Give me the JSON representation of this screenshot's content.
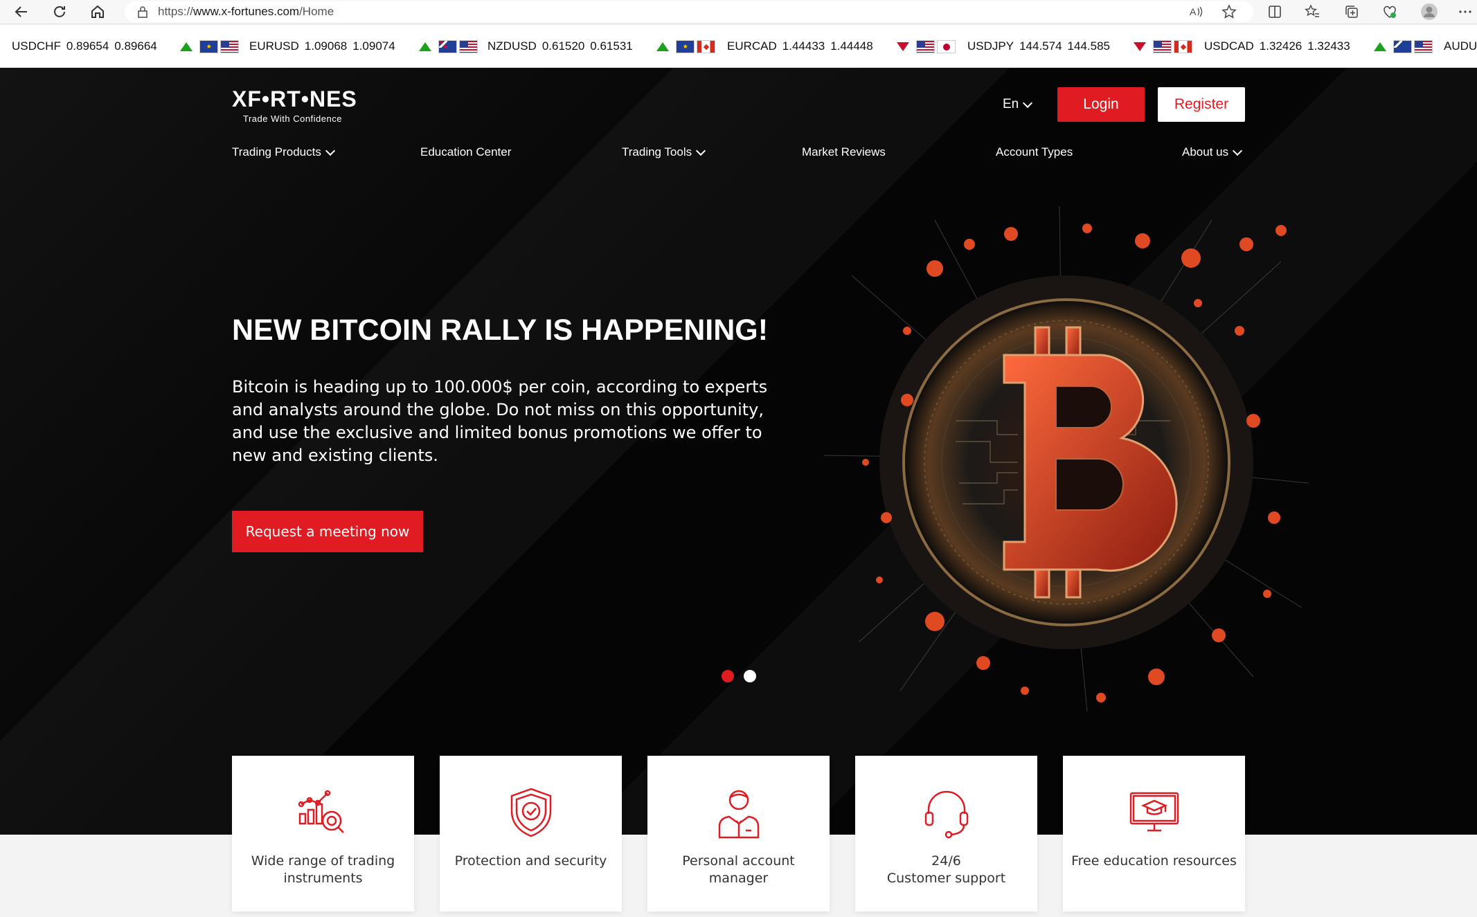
{
  "browser": {
    "url_prefix": "https://",
    "url_host": "www.x-fortunes.com",
    "url_path": "/Home"
  },
  "ticker": [
    {
      "symbol": "USDCHF",
      "bid": "0.89654",
      "ask": "0.89664",
      "direction": "up"
    },
    {
      "symbol": "EURUSD",
      "bid": "1.09068",
      "ask": "1.09074",
      "direction": "up"
    },
    {
      "symbol": "NZDUSD",
      "bid": "0.61520",
      "ask": "0.61531",
      "direction": "up"
    },
    {
      "symbol": "EURCAD",
      "bid": "1.44433",
      "ask": "1.44448",
      "direction": "down"
    },
    {
      "symbol": "USDJPY",
      "bid": "144.574",
      "ask": "144.585",
      "direction": "down"
    },
    {
      "symbol": "USDCAD",
      "bid": "1.32426",
      "ask": "1.32433",
      "direction": "up"
    },
    {
      "symbol": "AUDU",
      "bid": "",
      "ask": "",
      "direction": ""
    }
  ],
  "header": {
    "logo_text": "XF•RT•NES",
    "logo_tagline": "Trade With Confidence",
    "language": "En",
    "login_label": "Login",
    "register_label": "Register"
  },
  "nav": {
    "trading_products": "Trading Products",
    "education_center": "Education Center",
    "trading_tools": "Trading Tools",
    "market_reviews": "Market Reviews",
    "account_types": "Account Types",
    "about_us": "About us"
  },
  "hero": {
    "title": "NEW BITCOIN RALLY IS HAPPENING!",
    "text": "Bitcoin is heading up to 100.000$ per coin, according to experts and analysts around the globe. Do not miss on this opportunity, and use the exclusive and limited bonus promotions we offer to new and existing clients.",
    "cta_label": "Request a meeting now",
    "active_slide": 1,
    "slide_count": 2
  },
  "features": {
    "wide_range": "Wide range of trading instruments",
    "protection": "Protection and security",
    "account_manager": "Personal account manager",
    "support_line1": "24/6",
    "support_line2": "Customer support",
    "education": "Free education resources"
  },
  "colors": {
    "brand_red": "#e11b22",
    "hero_bg": "#050505"
  }
}
